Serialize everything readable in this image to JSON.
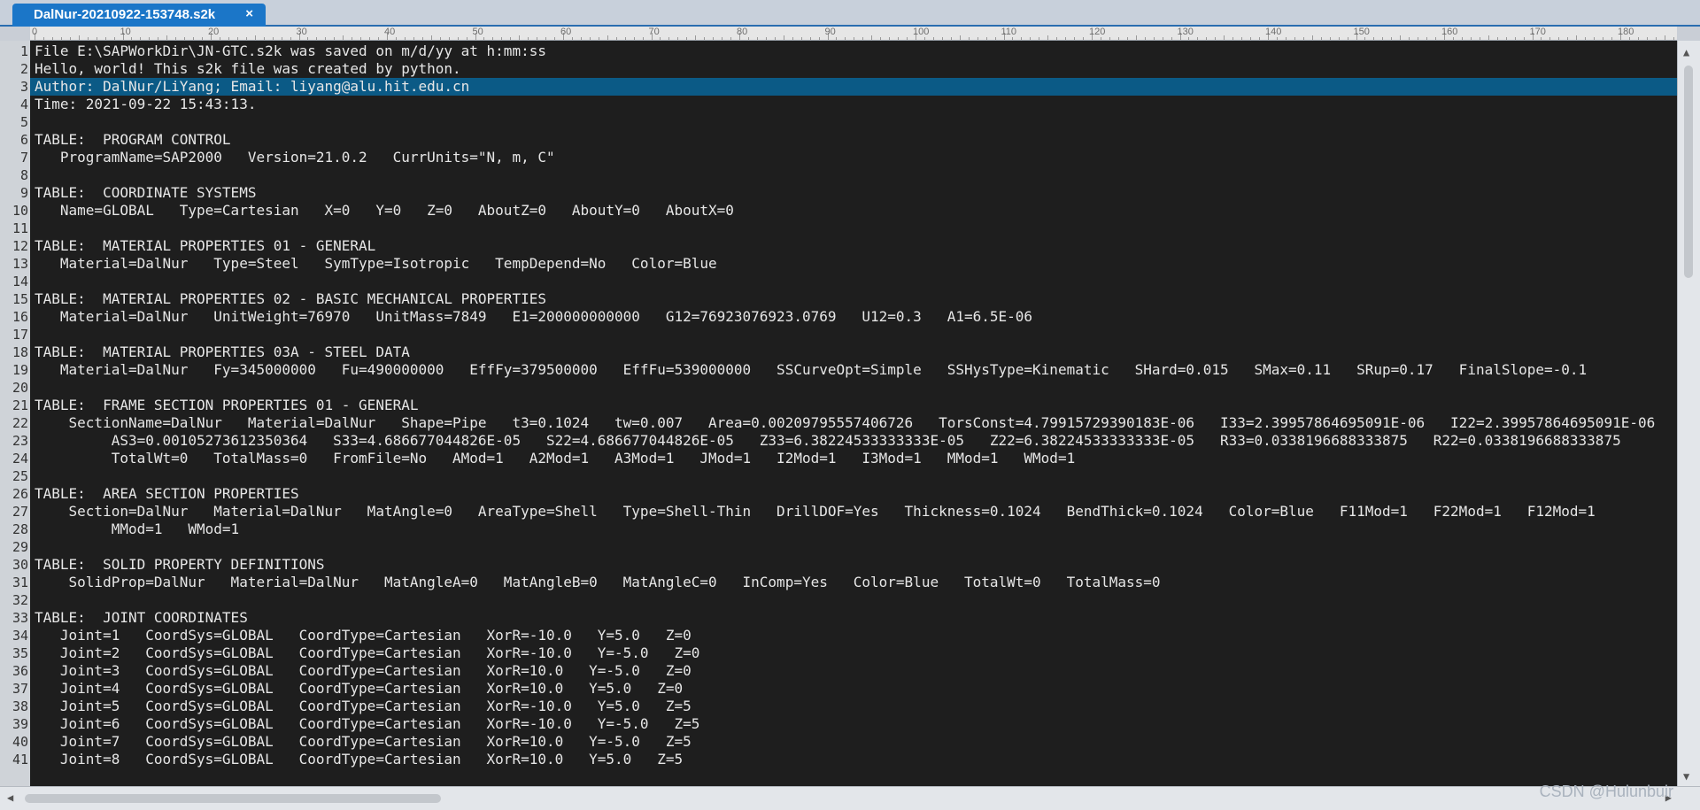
{
  "tab": {
    "title": "DalNur-20210922-153748.s2k",
    "close": "×"
  },
  "ruler": {
    "labels": [
      "0",
      "10",
      "20",
      "30",
      "40",
      "50",
      "60",
      "70",
      "80",
      "90",
      "100",
      "110",
      "120",
      "130",
      "140",
      "150",
      "160",
      "170",
      "180"
    ]
  },
  "editor": {
    "current_line": 3,
    "lines": [
      "File E:\\SAPWorkDir\\JN-GTC.s2k was saved on m/d/yy at h:mm:ss",
      "Hello, world! This s2k file was created by python.",
      "Author: DalNur/LiYang; Email: liyang@alu.hit.edu.cn",
      "Time: 2021-09-22 15:43:13.",
      "",
      "TABLE:  PROGRAM CONTROL",
      "   ProgramName=SAP2000   Version=21.0.2   CurrUnits=\"N, m, C\"",
      "",
      "TABLE:  COORDINATE SYSTEMS",
      "   Name=GLOBAL   Type=Cartesian   X=0   Y=0   Z=0   AboutZ=0   AboutY=0   AboutX=0",
      "",
      "TABLE:  MATERIAL PROPERTIES 01 - GENERAL",
      "   Material=DalNur   Type=Steel   SymType=Isotropic   TempDepend=No   Color=Blue",
      "",
      "TABLE:  MATERIAL PROPERTIES 02 - BASIC MECHANICAL PROPERTIES",
      "   Material=DalNur   UnitWeight=76970   UnitMass=7849   E1=200000000000   G12=76923076923.0769   U12=0.3   A1=6.5E-06",
      "",
      "TABLE:  MATERIAL PROPERTIES 03A - STEEL DATA",
      "   Material=DalNur   Fy=345000000   Fu=490000000   EffFy=379500000   EffFu=539000000   SSCurveOpt=Simple   SSHysType=Kinematic   SHard=0.015   SMax=0.11   SRup=0.17   FinalSlope=-0.1",
      "",
      "TABLE:  FRAME SECTION PROPERTIES 01 - GENERAL",
      "    SectionName=DalNur   Material=DalNur   Shape=Pipe   t3=0.1024   tw=0.007   Area=0.00209795557406726   TorsConst=4.79915729390183E-06   I33=2.39957864695091E-06   I22=2.39957864695091E-06",
      "         AS3=0.00105273612350364   S33=4.686677044826E-05   S22=4.686677044826E-05   Z33=6.38224533333333E-05   Z22=6.38224533333333E-05   R33=0.0338196688333875   R22=0.0338196688333875",
      "         TotalWt=0   TotalMass=0   FromFile=No   AMod=1   A2Mod=1   A3Mod=1   JMod=1   I2Mod=1   I3Mod=1   MMod=1   WMod=1",
      "",
      "TABLE:  AREA SECTION PROPERTIES",
      "    Section=DalNur   Material=DalNur   MatAngle=0   AreaType=Shell   Type=Shell-Thin   DrillDOF=Yes   Thickness=0.1024   BendThick=0.1024   Color=Blue   F11Mod=1   F22Mod=1   F12Mod=1",
      "         MMod=1   WMod=1",
      "",
      "TABLE:  SOLID PROPERTY DEFINITIONS",
      "    SolidProp=DalNur   Material=DalNur   MatAngleA=0   MatAngleB=0   MatAngleC=0   InComp=Yes   Color=Blue   TotalWt=0   TotalMass=0",
      "",
      "TABLE:  JOINT COORDINATES",
      "   Joint=1   CoordSys=GLOBAL   CoordType=Cartesian   XorR=-10.0   Y=5.0   Z=0",
      "   Joint=2   CoordSys=GLOBAL   CoordType=Cartesian   XorR=-10.0   Y=-5.0   Z=0",
      "   Joint=3   CoordSys=GLOBAL   CoordType=Cartesian   XorR=10.0   Y=-5.0   Z=0",
      "   Joint=4   CoordSys=GLOBAL   CoordType=Cartesian   XorR=10.0   Y=5.0   Z=0",
      "   Joint=5   CoordSys=GLOBAL   CoordType=Cartesian   XorR=-10.0   Y=5.0   Z=5",
      "   Joint=6   CoordSys=GLOBAL   CoordType=Cartesian   XorR=-10.0   Y=-5.0   Z=5",
      "   Joint=7   CoordSys=GLOBAL   CoordType=Cartesian   XorR=10.0   Y=-5.0   Z=5",
      "   Joint=8   CoordSys=GLOBAL   CoordType=Cartesian   XorR=10.0   Y=5.0   Z=5"
    ]
  },
  "watermark": "CSDN @Hulunbuir",
  "colors": {
    "tab": "#1b76c8",
    "editor_bg": "#1e1e1e",
    "current_line": "#0b5a86",
    "text": "#e6e6e6"
  }
}
